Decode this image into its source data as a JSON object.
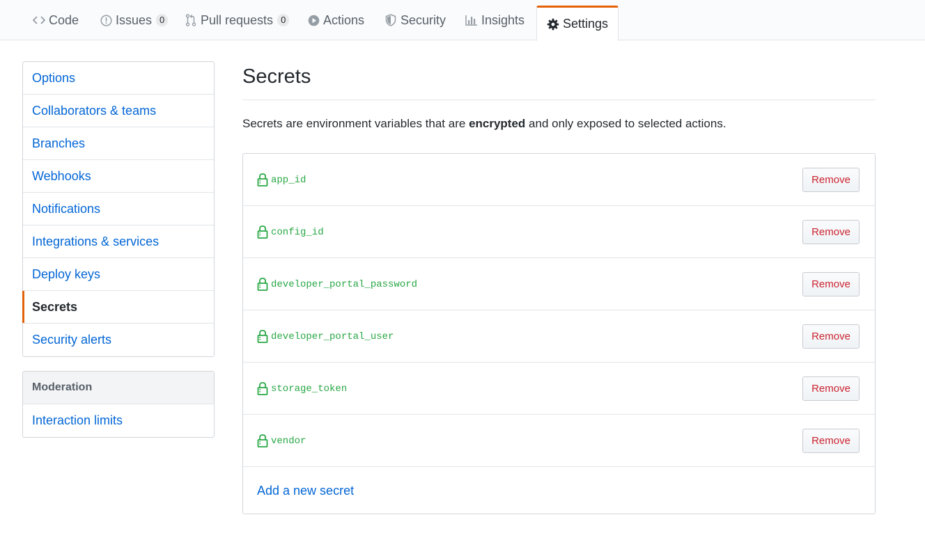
{
  "tabs": [
    {
      "label": "Code",
      "icon": "code-icon",
      "counter": null,
      "selected": false
    },
    {
      "label": "Issues",
      "icon": "issue-opened-icon",
      "counter": "0",
      "selected": false
    },
    {
      "label": "Pull requests",
      "icon": "git-pull-request-icon",
      "counter": "0",
      "selected": false
    },
    {
      "label": "Actions",
      "icon": "play-icon",
      "counter": null,
      "selected": false
    },
    {
      "label": "Security",
      "icon": "shield-icon",
      "counter": null,
      "selected": false
    },
    {
      "label": "Insights",
      "icon": "graph-icon",
      "counter": null,
      "selected": false
    },
    {
      "label": "Settings",
      "icon": "gear-icon",
      "counter": null,
      "selected": true
    }
  ],
  "sidebar": {
    "items": [
      {
        "label": "Options"
      },
      {
        "label": "Collaborators & teams"
      },
      {
        "label": "Branches"
      },
      {
        "label": "Webhooks"
      },
      {
        "label": "Notifications"
      },
      {
        "label": "Integrations & services"
      },
      {
        "label": "Deploy keys"
      },
      {
        "label": "Secrets",
        "selected": true
      },
      {
        "label": "Security alerts"
      }
    ],
    "moderation": {
      "heading": "Moderation",
      "items": [
        {
          "label": "Interaction limits"
        }
      ]
    }
  },
  "main": {
    "title": "Secrets",
    "description_before": "Secrets are environment variables that are ",
    "description_bold": "encrypted",
    "description_after": " and only exposed to selected actions.",
    "secrets": [
      {
        "name": "app_id"
      },
      {
        "name": "config_id"
      },
      {
        "name": "developer_portal_password"
      },
      {
        "name": "developer_portal_user"
      },
      {
        "name": "storage_token"
      },
      {
        "name": "vendor"
      }
    ],
    "remove_label": "Remove",
    "add_label": "Add a new secret"
  },
  "colors": {
    "accent_orange": "#e36209",
    "link_blue": "#0366d6",
    "secret_green": "#28a745",
    "danger_red": "#cb2431"
  }
}
